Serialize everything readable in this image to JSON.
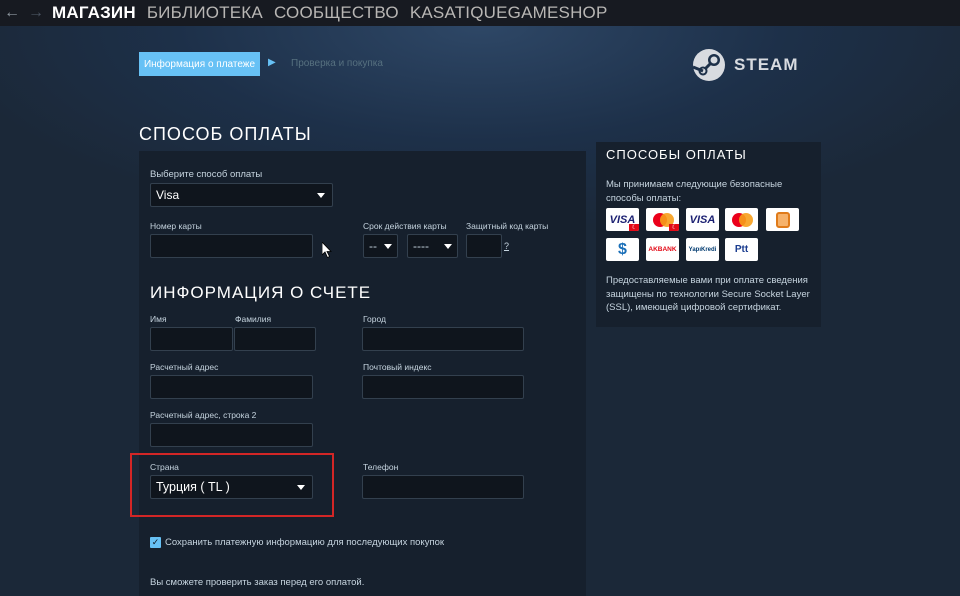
{
  "nav": {
    "back_icon": "back-arrow-icon",
    "forward_icon": "forward-arrow-icon",
    "items": [
      "МАГАЗИН",
      "БИБЛИОТЕКА",
      "СООБЩЕСТВО",
      "KASATIQUEGAMESHOP"
    ]
  },
  "steps": {
    "active": "Информация о платеже",
    "next": "Проверка и покупка"
  },
  "brand": {
    "name": "STEAM"
  },
  "payment": {
    "title": "СПОСОБ ОПЛАТЫ",
    "method_label": "Выберите способ оплаты",
    "method_value": "Visa",
    "card_number_label": "Номер карты",
    "card_number_value": "",
    "expiry_label": "Срок действия карты",
    "expiry_month": "--",
    "expiry_year": "----",
    "cvv_label": "Защитный код карты",
    "cvv_value": "",
    "cvv_help": "?"
  },
  "billing": {
    "title": "ИНФОРМАЦИЯ О СЧЕТЕ",
    "first_name_label": "Имя",
    "last_name_label": "Фамилия",
    "city_label": "Город",
    "address_label": "Расчетный адрес",
    "postal_label": "Почтовый индекс",
    "address2_label": "Расчетный адрес, строка 2",
    "country_label": "Страна",
    "country_value": "Турция ( TL )",
    "phone_label": "Телефон",
    "save_checked": true,
    "save_label": "Сохранить платежную информацию для последующих покупок",
    "review_note": "Вы сможете проверить заказ перед его оплатой."
  },
  "methods_panel": {
    "title": "СПОСОБЫ ОПЛАТЫ",
    "intro": "Мы принимаем следующие безопасные способы оплаты:",
    "note": "Предоставляемые вами при оплате сведения защищены по технологии Secure Socket Layer (SSL), имеющей цифровой сертификат.",
    "logos": {
      "visa": "VISA",
      "akbank": "AKBANK",
      "yapikredi": "YapıKredi",
      "ptt": "Ptt",
      "flag": "☾"
    }
  },
  "colors": {
    "accent": "#67c1f5",
    "background": "#1b2838",
    "highlight": "#d32626"
  }
}
